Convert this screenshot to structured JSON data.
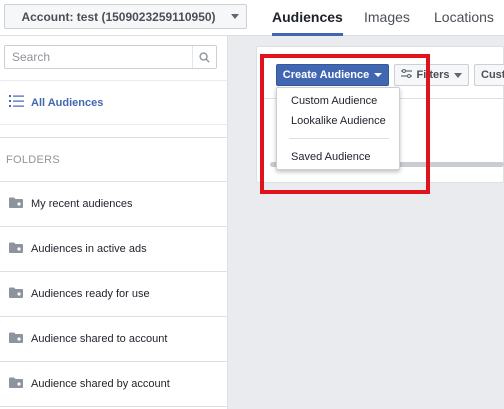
{
  "header": {
    "account_label": "Account: test (1509023259110950)",
    "tabs": [
      {
        "label": "Audiences",
        "active": true
      },
      {
        "label": "Images",
        "active": false
      },
      {
        "label": "Locations",
        "active": false
      }
    ]
  },
  "sidebar": {
    "search_placeholder": "Search",
    "all_audiences_label": "All Audiences",
    "folders_heading": "FOLDERS",
    "folders": [
      {
        "label": "My recent audiences"
      },
      {
        "label": "Audiences in active ads"
      },
      {
        "label": "Audiences ready for use"
      },
      {
        "label": "Audience shared to account"
      },
      {
        "label": "Audience shared by account"
      }
    ]
  },
  "toolbar": {
    "create_audience_label": "Create Audience",
    "filters_label": "Filters",
    "customize_label": "Cust"
  },
  "create_menu": {
    "items": [
      {
        "label": "Custom Audience"
      },
      {
        "label": "Lookalike Audience"
      },
      {
        "label": "Saved Audience"
      }
    ]
  },
  "colors": {
    "accent": "#4267b2",
    "highlight": "#e0121c"
  }
}
